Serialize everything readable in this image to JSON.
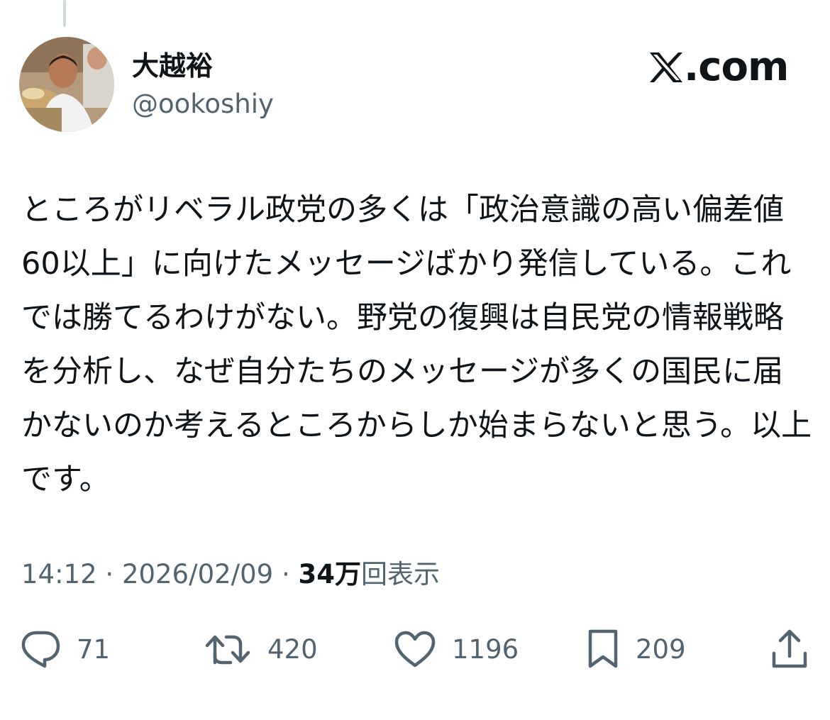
{
  "author": {
    "display_name": "大越裕",
    "handle": "@ookoshiy"
  },
  "site": {
    "logo_text": ".com"
  },
  "tweet": {
    "text": "ところがリベラル政党の多くは「政治意識の高い偏差値60以上」に向けたメッセージばかり発信している。これでは勝てるわけがない。野党の復興は自民党の情報戦略を分析し、なぜ自分たちのメッセージが多くの国民に届かないのか考えるところからしか始まらないと思う。以上です。",
    "time": "14:12",
    "date": "2026/02/09",
    "separator": "·",
    "views_count": "34万",
    "views_label": "回表示"
  },
  "actions": {
    "replies": "71",
    "retweets": "420",
    "likes": "1196",
    "bookmarks": "209"
  },
  "icons": {
    "avatar": "avatar-photo",
    "logo": "x-logo-icon",
    "reply": "reply-icon",
    "retweet": "retweet-icon",
    "like": "heart-icon",
    "bookmark": "bookmark-icon",
    "share": "share-icon"
  },
  "colors": {
    "text_primary": "#0f1419",
    "text_secondary": "#536471",
    "thread_line": "#cfd9de",
    "background": "#ffffff"
  }
}
